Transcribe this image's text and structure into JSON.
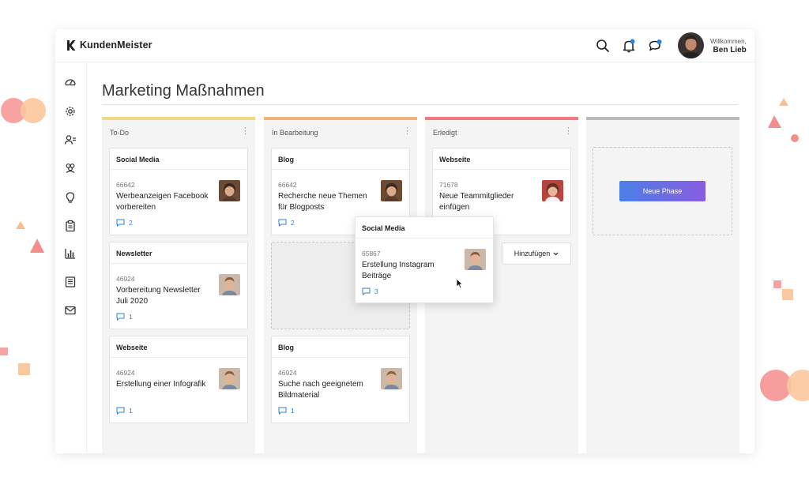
{
  "app": {
    "logo_text": "KundenMeister",
    "welcome_label": "Willkommen,",
    "user_name": "Ben Lieb"
  },
  "topbar": {
    "icons": [
      "search-icon",
      "bell-icon",
      "chat-icon"
    ],
    "notification_color": "#2e7fd9"
  },
  "sidebar": {
    "icons": [
      "dashboard-icon",
      "gear-icon",
      "user-list-icon",
      "group-icon",
      "lightbulb-icon",
      "clipboard-icon",
      "bar-chart-icon",
      "document-list-icon",
      "mail-icon"
    ]
  },
  "page": {
    "title": "Marketing Maßnahmen"
  },
  "columns": [
    {
      "title": "To-Do",
      "color": "#f1d983",
      "cards": [
        {
          "category": "Social Media",
          "id": "66642",
          "text": "Werbeanzeigen Facebook vorbereiten",
          "comments": "2"
        },
        {
          "category": "Newsletter",
          "id": "46924",
          "text": "Vorbereitung Newsletter Juli 2020",
          "comments": "1"
        },
        {
          "category": "Webseite",
          "id": "46924",
          "text": "Erstellung einer Infografik",
          "comments": "1"
        }
      ]
    },
    {
      "title": "In Bearbeitung",
      "color": "#f3b27a",
      "cards": [
        {
          "category": "Blog",
          "id": "66642",
          "text": "Recherche neue Themen für Blogposts",
          "comments": "2"
        },
        {
          "category": "Blog",
          "id": "46924",
          "text": "Suche nach geeignetem Bildmaterial",
          "comments": "1"
        }
      ]
    },
    {
      "title": "Erledigt",
      "color": "#ee7a83",
      "cards": [
        {
          "category": "Webseite",
          "id": "71678",
          "text": "Neue Teammitglieder einfügen",
          "comments": ""
        }
      ],
      "add_label": "Hinzufügen"
    },
    {
      "title": "",
      "color": "#b9babd",
      "new_phase_label": "Neue Phase"
    }
  ],
  "dragging_card": {
    "category": "Social Media",
    "id": "65867",
    "text": "Erstellung Instagram Beiträge",
    "comments": "3"
  }
}
